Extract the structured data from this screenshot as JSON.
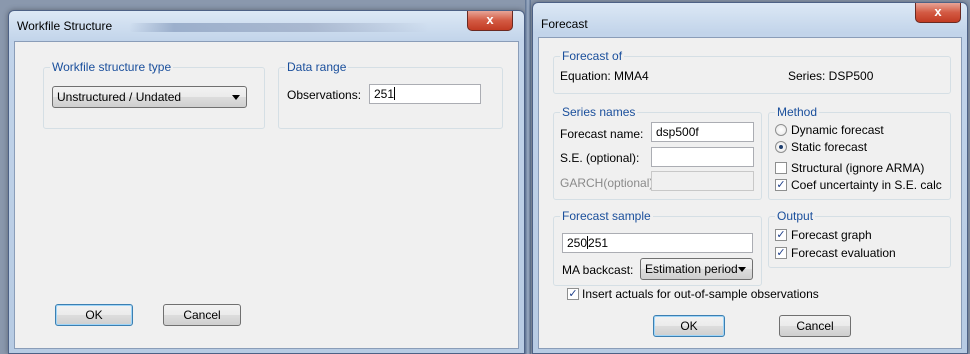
{
  "workfile": {
    "title": "Workfile Structure",
    "close_label": "x",
    "structure_group_label": "Workfile structure type",
    "structure_selected": "Unstructured / Undated",
    "range_group_label": "Data range",
    "observations_label": "Observations:",
    "observations_value": "251",
    "ok_label": "OK",
    "cancel_label": "Cancel"
  },
  "forecast": {
    "title": "Forecast",
    "close_label": "x",
    "forecast_of_label": "Forecast of",
    "equation_text": "Equation: MMA4",
    "series_text": "Series: DSP500",
    "series_names_label": "Series names",
    "forecast_name_label": "Forecast name:",
    "forecast_name_value": "dsp500f",
    "se_label": "S.E. (optional):",
    "se_value": "",
    "garch_label": "GARCH(optional):",
    "garch_value": "",
    "method_label": "Method",
    "dynamic_label": "Dynamic forecast",
    "static_label": "Static forecast",
    "method_selected": "static",
    "structural_label": "Structural (ignore ARMA)",
    "structural_checked": false,
    "coef_label": "Coef uncertainty in S.E. calc",
    "coef_checked": true,
    "sample_label": "Forecast sample",
    "sample_value_a": "250",
    "sample_value_b": "251",
    "ma_backcast_label": "MA backcast:",
    "ma_backcast_value": "Estimation period",
    "output_label": "Output",
    "graph_label": "Forecast graph",
    "graph_checked": true,
    "evaluation_label": "Forecast evaluation",
    "evaluation_checked": true,
    "insert_actuals_label": "Insert actuals for out-of-sample observations",
    "insert_actuals_checked": true,
    "ok_label": "OK",
    "cancel_label": "Cancel"
  }
}
